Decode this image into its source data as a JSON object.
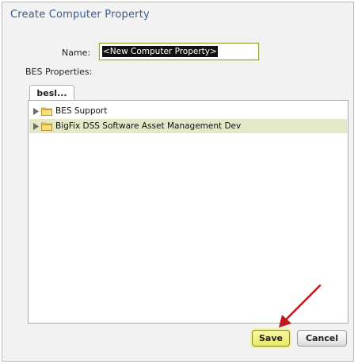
{
  "dialog": {
    "title": "Create Computer Property"
  },
  "form": {
    "name_label": "Name:",
    "name_value": "<New Computer Property>",
    "bes_properties_label": "BES Properties:"
  },
  "tabs": [
    {
      "label": "besl..."
    }
  ],
  "tree": {
    "items": [
      {
        "label": "BES Support",
        "icon": "folder-icon",
        "selected": false
      },
      {
        "label": "BigFix DSS Software Asset Management Dev",
        "icon": "folder-icon",
        "selected": true
      }
    ]
  },
  "buttons": {
    "save_label": "Save",
    "cancel_label": "Cancel"
  },
  "colors": {
    "title": "#3a5a8c",
    "selected_row": "#e3e8c6",
    "save_button": "#f0f07a",
    "annotation_arrow": "#c0181e"
  }
}
